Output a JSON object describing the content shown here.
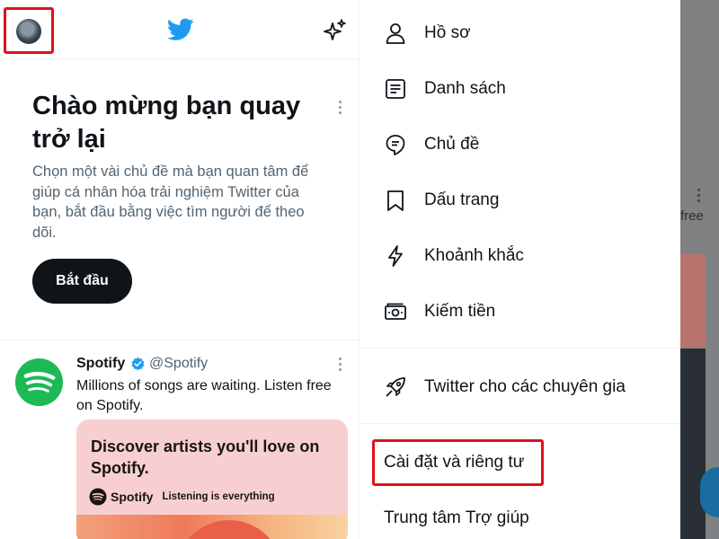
{
  "left_panel": {
    "welcome": {
      "title": "Chào mừng bạn quay trở lại",
      "description": "Chọn một vài chủ đề mà bạn quan tâm để giúp cá nhân hóa trải nghiệm Twitter của bạn, bắt đầu bằng việc tìm người để theo dõi.",
      "start_button": "Bắt đầu"
    },
    "tweet": {
      "name": "Spotify",
      "handle": "@Spotify",
      "text": "Millions of songs are waiting. Listen free on Spotify.",
      "card": {
        "title": "Discover artists you'll love on Spotify.",
        "brand": "Spotify",
        "tagline": "Listening is everything"
      }
    }
  },
  "menu": {
    "items": [
      {
        "label": "Hồ sơ",
        "icon": "profile-icon"
      },
      {
        "label": "Danh sách",
        "icon": "lists-icon"
      },
      {
        "label": "Chủ đề",
        "icon": "topics-icon"
      },
      {
        "label": "Dấu trang",
        "icon": "bookmark-icon"
      },
      {
        "label": "Khoảnh khắc",
        "icon": "moments-icon"
      },
      {
        "label": "Kiếm tiền",
        "icon": "monetization-icon"
      },
      {
        "label": "Twitter cho các chuyên gia",
        "icon": "rocket-icon"
      }
    ],
    "settings": "Cài đặt và riêng tư",
    "help": "Trung tâm Trợ giúp"
  },
  "background": {
    "partial_text": "free"
  },
  "colors": {
    "twitter_blue": "#1d9bf0",
    "spotify_green": "#1db954",
    "highlight_red": "#e0101c",
    "card_pink": "#f7cfd0"
  }
}
